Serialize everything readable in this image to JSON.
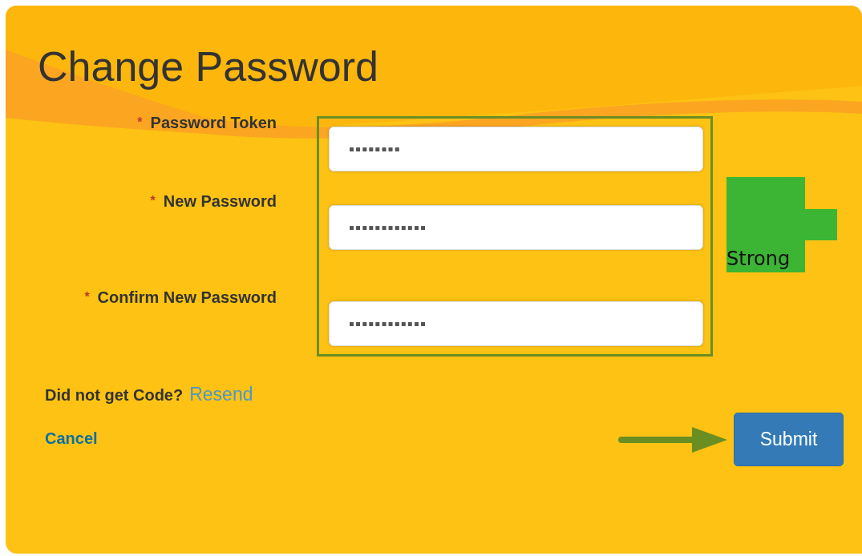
{
  "title": "Change Password",
  "fields": [
    {
      "required_mark": "*",
      "label": "Password Token",
      "value": "▪▪▪▪▪▪▪▪"
    },
    {
      "required_mark": "*",
      "label": "New Password",
      "value": "▪▪▪▪▪▪▪▪▪▪▪▪"
    },
    {
      "required_mark": "*",
      "label": "Confirm New Password",
      "value": "▪▪▪▪▪▪▪▪▪▪▪▪"
    }
  ],
  "strength": {
    "label": "Strong",
    "color": "#3cb534"
  },
  "resend": {
    "prompt": "Did not get Code?",
    "link": "Resend"
  },
  "cancel": "Cancel",
  "submit": "Submit"
}
